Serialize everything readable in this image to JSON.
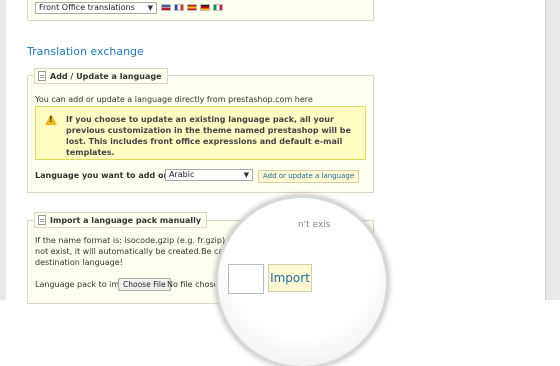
{
  "top_panel": {
    "select_value": "Front Office translations",
    "flags": [
      {
        "name": "us-flag",
        "color": "#3c5aa6"
      },
      {
        "name": "fr-flag",
        "color": "#2450a8"
      },
      {
        "name": "es-flag",
        "color": "#c8102e"
      },
      {
        "name": "de-flag",
        "color": "#222222"
      },
      {
        "name": "it-flag",
        "color": "#009246"
      }
    ]
  },
  "section_title": "Translation exchange",
  "add_update": {
    "legend": "Add / Update a language",
    "intro": "You can add or update a language directly from prestashop.com here",
    "warning": "If you choose to update an existing language pack, all your previous customization in the theme named prestashop will be lost. This includes front office expressions and default e-mail templates.",
    "language_label": "Language you want to add or update:",
    "language_value": "Arabic",
    "submit_label": "Add or update a language"
  },
  "import_pack": {
    "legend": "Import a language pack manually",
    "line1": "If the name format is: isocode.gzip (e.g. fr.gzip) and the language",
    "line1_tail": "es",
    "line2": "not exist, it will automatically be created.Be careful, as this wi",
    "line3": "destination language!",
    "file_label": "Language pack to import:",
    "file_button": "Choose File",
    "file_status": "No file chosen",
    "magnified_ghost": "n't exis",
    "import_label": "Import"
  }
}
